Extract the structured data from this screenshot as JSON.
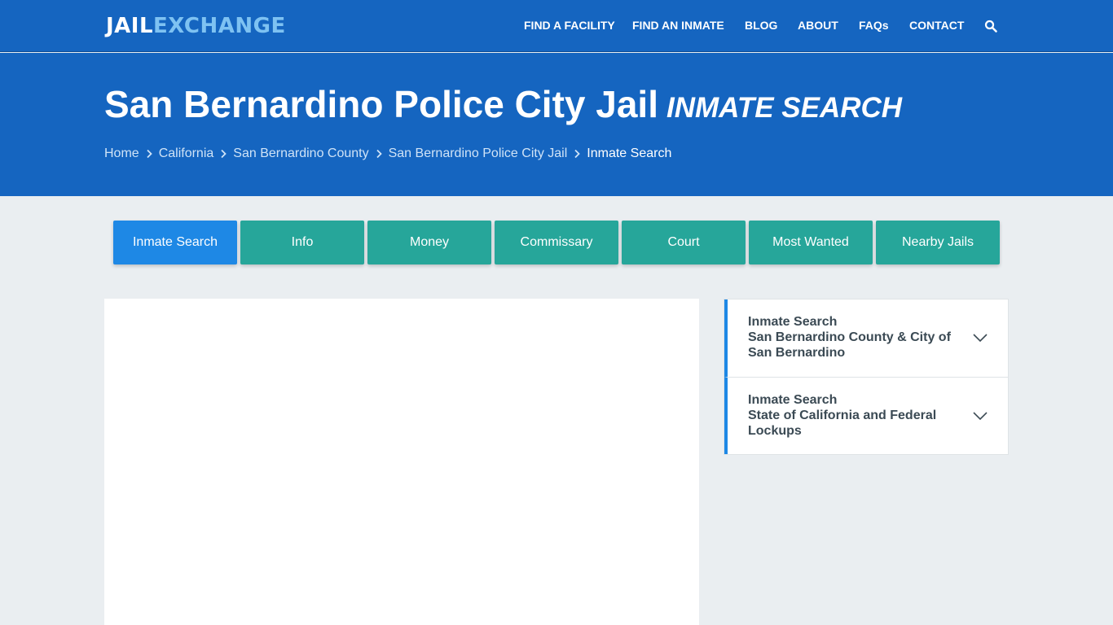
{
  "header": {
    "logo_part1": "JAIL",
    "logo_part2": "EXCHANGE",
    "nav": [
      "FIND A FACILITY",
      "FIND AN INMATE",
      "BLOG",
      "ABOUT",
      "FAQs",
      "CONTACT"
    ],
    "search_icon": "search-icon"
  },
  "hero": {
    "title": "San Bernardino Police City Jail",
    "subtitle": "INMATE SEARCH",
    "breadcrumb": [
      "Home",
      "California",
      "San Bernardino County",
      "San Bernardino Police City Jail",
      "Inmate Search"
    ]
  },
  "tabs": [
    "Inmate Search",
    "Info",
    "Money",
    "Commissary",
    "Court",
    "Most Wanted",
    "Nearby Jails"
  ],
  "active_tab": "Inmate Search",
  "sidebar": {
    "items": [
      {
        "line1": "Inmate Search",
        "line2": "San Bernardino County & City of San Bernardino"
      },
      {
        "line1": "Inmate Search",
        "line2": "State of California and Federal Lockups"
      }
    ]
  },
  "colors": {
    "header_bg": "#1565c0",
    "logo_accent": "#7ec2f2",
    "tab_bg": "#26a69a",
    "tab_active_bg": "#1e88e5",
    "page_bg": "#eaeef1"
  }
}
